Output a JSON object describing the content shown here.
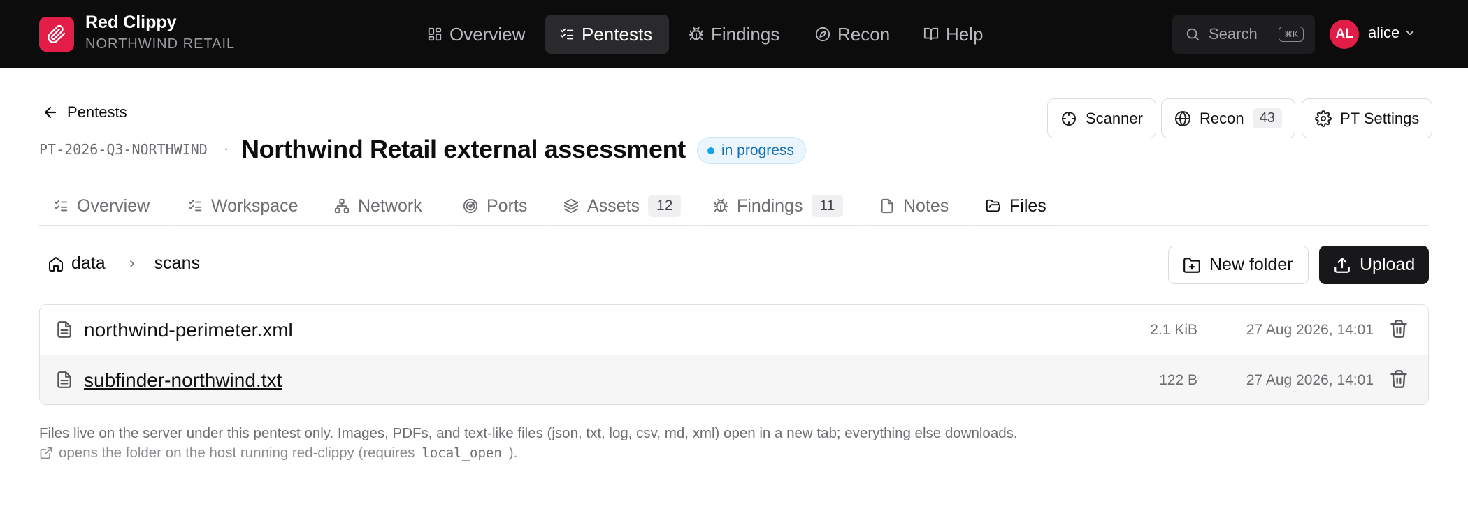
{
  "brand": {
    "name": "Red Clippy",
    "org": "NORTHWIND RETAIL",
    "color": "#e11d48",
    "icon": "paperclip-icon"
  },
  "nav": {
    "items": [
      {
        "label": "Overview",
        "icon": "grid-icon"
      },
      {
        "label": "Pentests",
        "icon": "checklist-icon",
        "active": true
      },
      {
        "label": "Findings",
        "icon": "bug-icon"
      },
      {
        "label": "Recon",
        "icon": "compass-icon"
      },
      {
        "label": "Help",
        "icon": "book-icon"
      }
    ],
    "search_label": "Search",
    "search_shortcut": "⌘K"
  },
  "user": {
    "initials": "AL",
    "name": "alice",
    "avatar_color": "#e11d48"
  },
  "header": {
    "back_label": "Pentests",
    "pentest_id": "PT-2026-Q3-NORTHWIND",
    "separator": "·",
    "title": "Northwind Retail external assessment",
    "status": "in progress",
    "status_color": "#0ea5e9",
    "actions": {
      "scanner": "Scanner",
      "recon": "Recon",
      "recon_count": "43",
      "settings": "PT Settings"
    }
  },
  "tabs": [
    {
      "label": "Overview",
      "icon": "checklist-icon"
    },
    {
      "label": "Workspace",
      "icon": "checklist-icon"
    },
    {
      "label": "Network",
      "icon": "network-icon"
    },
    {
      "label": "Ports",
      "icon": "radar-icon"
    },
    {
      "label": "Assets",
      "icon": "layers-icon",
      "count": "12"
    },
    {
      "label": "Findings",
      "icon": "bug-icon",
      "count": "11"
    },
    {
      "label": "Notes",
      "icon": "file-icon"
    },
    {
      "label": "Files",
      "icon": "folder-open-icon",
      "active": true
    }
  ],
  "breadcrumb": {
    "root": "data",
    "current": "scans"
  },
  "actions": {
    "new_folder": "New folder",
    "upload": "Upload"
  },
  "files": [
    {
      "name": "northwind-perimeter.xml",
      "size": "2.1 KiB",
      "date": "27 Aug 2026, 14:01"
    },
    {
      "name": "subfinder-northwind.txt",
      "size": "122 B",
      "date": "27 Aug 2026, 14:01"
    }
  ],
  "notes": {
    "line1": "Files live on the server under this pentest only. Images, PDFs, and text-like files (json, txt, log, csv, md, xml) open in a new tab; everything else downloads.",
    "line2_prefix": "opens the folder on the host running red-clippy (requires",
    "line2_code": "local_open",
    "line2_suffix": ")."
  }
}
